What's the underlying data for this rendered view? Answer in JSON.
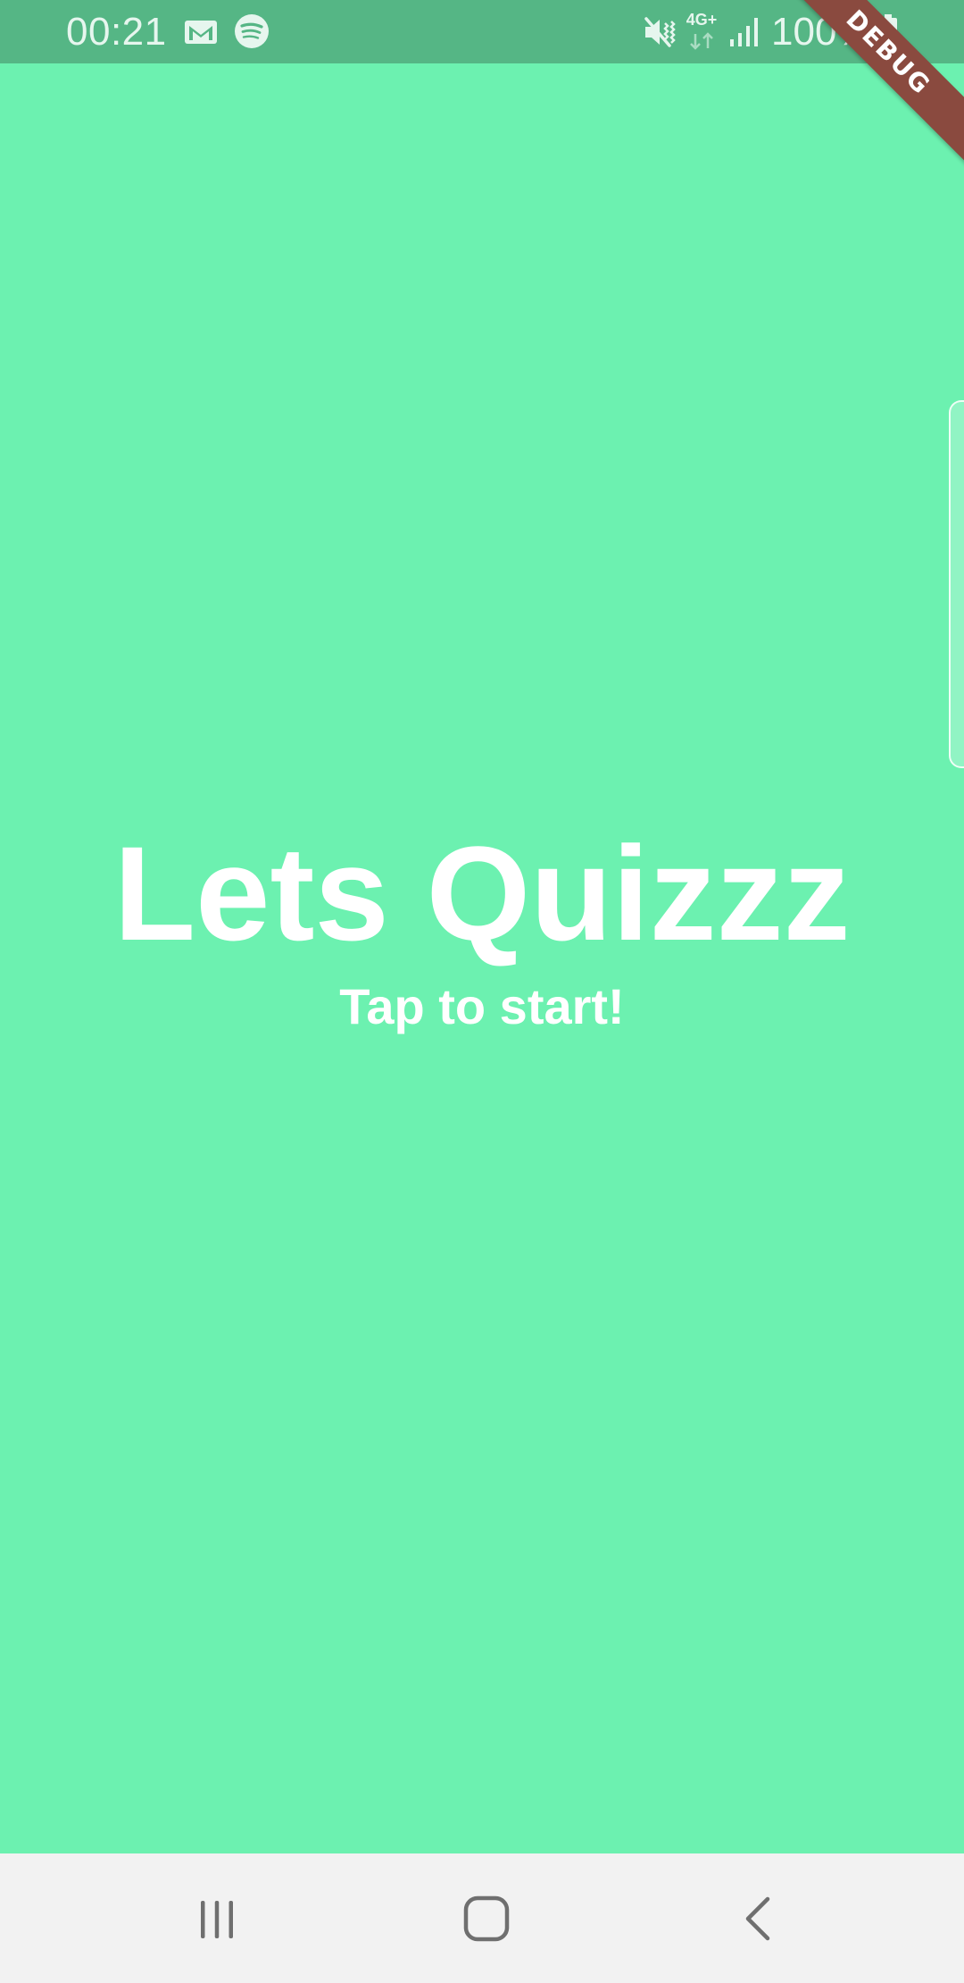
{
  "status_bar": {
    "time": "00:21",
    "network_type": "4G+",
    "battery": "100%",
    "icons": [
      "gmail-icon",
      "spotify-icon",
      "mute-icon",
      "signal-icon",
      "battery-icon"
    ]
  },
  "debug_banner": {
    "label": "DEBUG"
  },
  "main": {
    "title": "Lets Quizzz",
    "subtitle": "Tap to start!"
  },
  "nav_bar": {
    "buttons": [
      "recents",
      "home",
      "back"
    ]
  },
  "colors": {
    "background": "#6cf1b0",
    "status_bar": "#55b685",
    "text": "#ffffff",
    "debug_banner": "#8a4a3f",
    "nav_bar": "#f2f2f2"
  }
}
